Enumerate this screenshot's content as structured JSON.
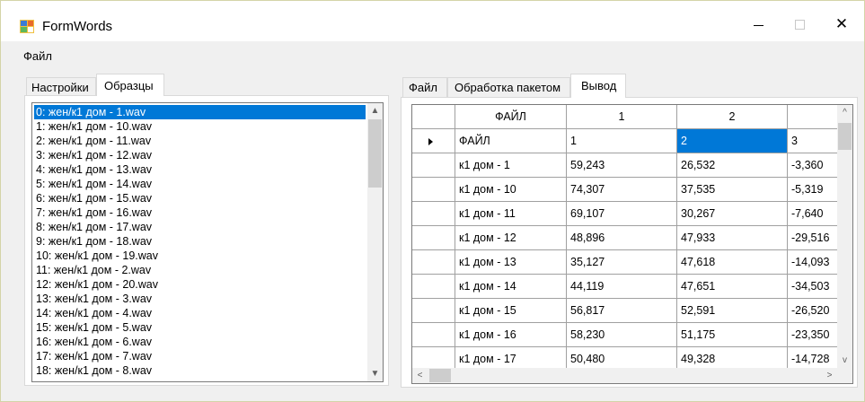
{
  "window": {
    "title": "FormWords",
    "icon": "app-form-icon",
    "controls": {
      "minimize": "minimize-icon",
      "maximize": "maximize-icon",
      "close": "close-icon",
      "close_glyph": "✕"
    }
  },
  "menu": {
    "items": [
      {
        "label": "Файл"
      }
    ]
  },
  "left_tabs": [
    {
      "label": "Настройки",
      "active": false
    },
    {
      "label": "Образцы",
      "active": true
    }
  ],
  "right_tabs": [
    {
      "label": "Файл",
      "active": false
    },
    {
      "label": "Обработка пакетом",
      "active": false
    },
    {
      "label": "Вывод",
      "active": true
    }
  ],
  "listbox": {
    "selected_index": 0,
    "items": [
      "0: жен/к1 дом - 1.wav",
      "1: жен/к1 дом - 10.wav",
      "2: жен/к1 дом - 11.wav",
      "3: жен/к1 дом - 12.wav",
      "4: жен/к1 дом - 13.wav",
      "5: жен/к1 дом - 14.wav",
      "6: жен/к1 дом - 15.wav",
      "7: жен/к1 дом - 16.wav",
      "8: жен/к1 дом - 17.wav",
      "9: жен/к1 дом - 18.wav",
      "10: жен/к1 дом - 19.wav",
      "11: жен/к1 дом - 2.wav",
      "12: жен/к1 дом - 20.wav",
      "13: жен/к1 дом - 3.wav",
      "14: жен/к1 дом - 4.wav",
      "15: жен/к1 дом - 5.wav",
      "16: жен/к1 дом - 6.wav",
      "17: жен/к1 дом - 7.wav",
      "18: жен/к1 дом - 8.wav"
    ],
    "scroll_up": "▲",
    "scroll_down": "▼"
  },
  "grid": {
    "columns": [
      "ФАЙЛ",
      "1",
      "2",
      ""
    ],
    "rows": [
      {
        "current": true,
        "cells": [
          "ФАЙЛ",
          "1",
          "2",
          "3"
        ],
        "selected_cell": 2
      },
      {
        "cells": [
          "к1 дом - 1",
          "59,243",
          "26,532",
          "-3,360"
        ]
      },
      {
        "cells": [
          "к1 дом - 10",
          "74,307",
          "37,535",
          "-5,319"
        ]
      },
      {
        "cells": [
          "к1 дом - 11",
          "69,107",
          "30,267",
          "-7,640"
        ]
      },
      {
        "cells": [
          "к1 дом - 12",
          "48,896",
          "47,933",
          "-29,516"
        ]
      },
      {
        "cells": [
          "к1 дом - 13",
          "35,127",
          "47,618",
          "-14,093"
        ]
      },
      {
        "cells": [
          "к1 дом - 14",
          "44,119",
          "47,651",
          "-34,503"
        ]
      },
      {
        "cells": [
          "к1 дом - 15",
          "56,817",
          "52,591",
          "-26,520"
        ]
      },
      {
        "cells": [
          "к1 дом - 16",
          "58,230",
          "51,175",
          "-23,350"
        ]
      },
      {
        "cells": [
          "к1 дом - 17",
          "50,480",
          "49,328",
          "-14,728"
        ]
      }
    ],
    "scroll_left": "<",
    "scroll_right": ">",
    "scroll_up": "^",
    "scroll_down": "v"
  },
  "colors": {
    "selection": "#0078d7",
    "window_bg": "#f0f0f0"
  }
}
